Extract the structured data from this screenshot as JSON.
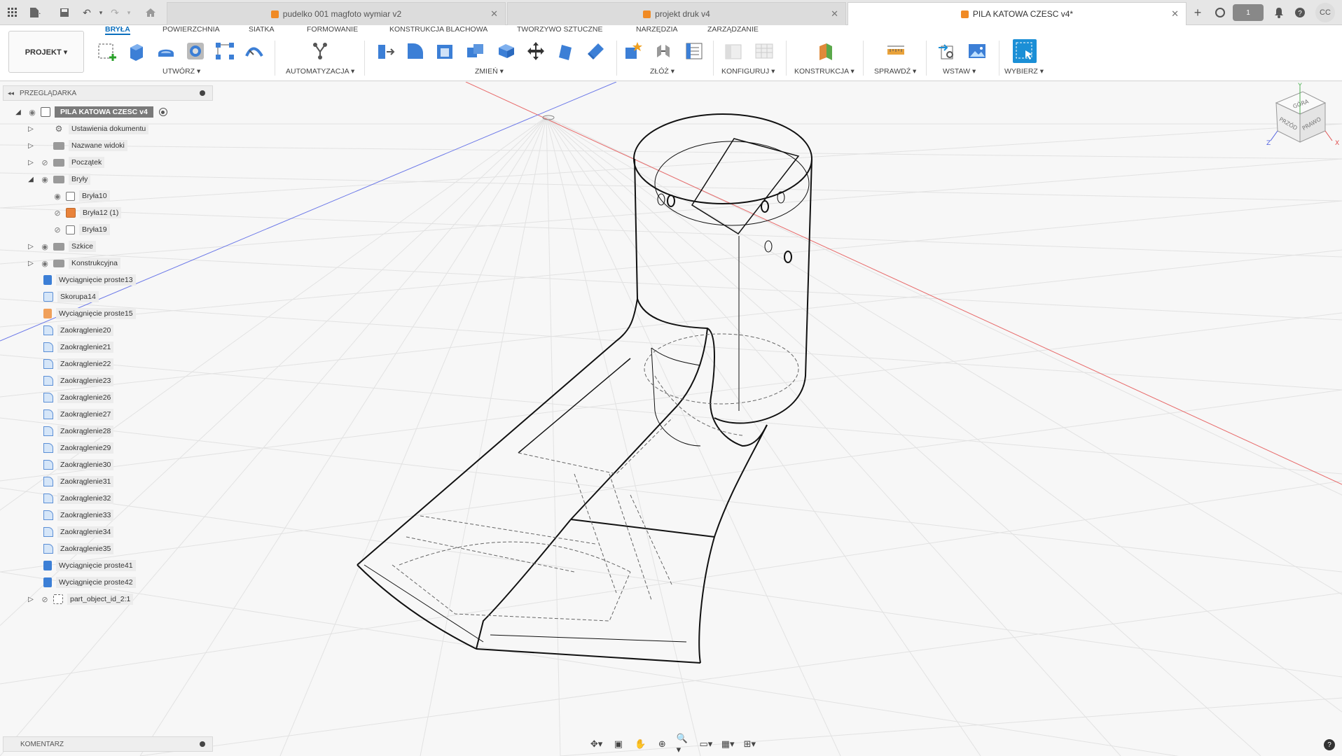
{
  "tabs": [
    {
      "label": "pudelko 001 magfoto wymiar v2",
      "active": false
    },
    {
      "label": "projekt druk v4",
      "active": false
    },
    {
      "label": "PILA KATOWA CZESC v4*",
      "active": true
    }
  ],
  "user_initials": "CC",
  "job_count": "1",
  "ribbon": {
    "project_button": "PROJEKT ▾",
    "tabs": [
      "BRYŁA",
      "POWIERZCHNIA",
      "SIATKA",
      "FORMOWANIE",
      "KONSTRUKCJA BLACHOWA",
      "TWORZYWO SZTUCZNE",
      "NARZĘDZIA",
      "ZARZĄDZANIE"
    ],
    "groups": [
      "UTWÓRZ ▾",
      "AUTOMATYZACJA ▾",
      "ZMIEŃ ▾",
      "ZŁÓŻ ▾",
      "KONFIGURUJ ▾",
      "KONSTRUKCJA ▾",
      "SPRAWDŹ ▾",
      "WSTAW ▾",
      "WYBIERZ ▾"
    ]
  },
  "browser": {
    "title": "PRZEGLĄDARKA",
    "root": "PILA KATOWA CZESC v4",
    "items": [
      {
        "label": "Ustawienia dokumentu"
      },
      {
        "label": "Nazwane widoki"
      },
      {
        "label": "Początek"
      },
      {
        "label": "Bryły"
      },
      {
        "label": "Bryła10"
      },
      {
        "label": "Bryła12 (1)"
      },
      {
        "label": "Bryła19"
      },
      {
        "label": "Szkice"
      },
      {
        "label": "Konstrukcyjna"
      },
      {
        "label": "Wyciągnięcie proste13"
      },
      {
        "label": "Skorupa14"
      },
      {
        "label": "Wyciągnięcie proste15"
      },
      {
        "label": "Zaokrąglenie20"
      },
      {
        "label": "Zaokrąglenie21"
      },
      {
        "label": "Zaokrąglenie22"
      },
      {
        "label": "Zaokrąglenie23"
      },
      {
        "label": "Zaokrąglenie26"
      },
      {
        "label": "Zaokrąglenie27"
      },
      {
        "label": "Zaokrąglenie28"
      },
      {
        "label": "Zaokrąglenie29"
      },
      {
        "label": "Zaokrąglenie30"
      },
      {
        "label": "Zaokrąglenie31"
      },
      {
        "label": "Zaokrąglenie32"
      },
      {
        "label": "Zaokrąglenie33"
      },
      {
        "label": "Zaokrąglenie34"
      },
      {
        "label": "Zaokrąglenie35"
      },
      {
        "label": "Wyciągnięcie proste41"
      },
      {
        "label": "Wyciągnięcie proste42"
      },
      {
        "label": "part_object_id_2:1"
      }
    ]
  },
  "comment_panel": "KOMENTARZ",
  "viewcube": {
    "top": "GÓRA",
    "front": "PRZÓD",
    "right": "PRAWO",
    "x": "X",
    "y": "Y",
    "z": "Z"
  }
}
